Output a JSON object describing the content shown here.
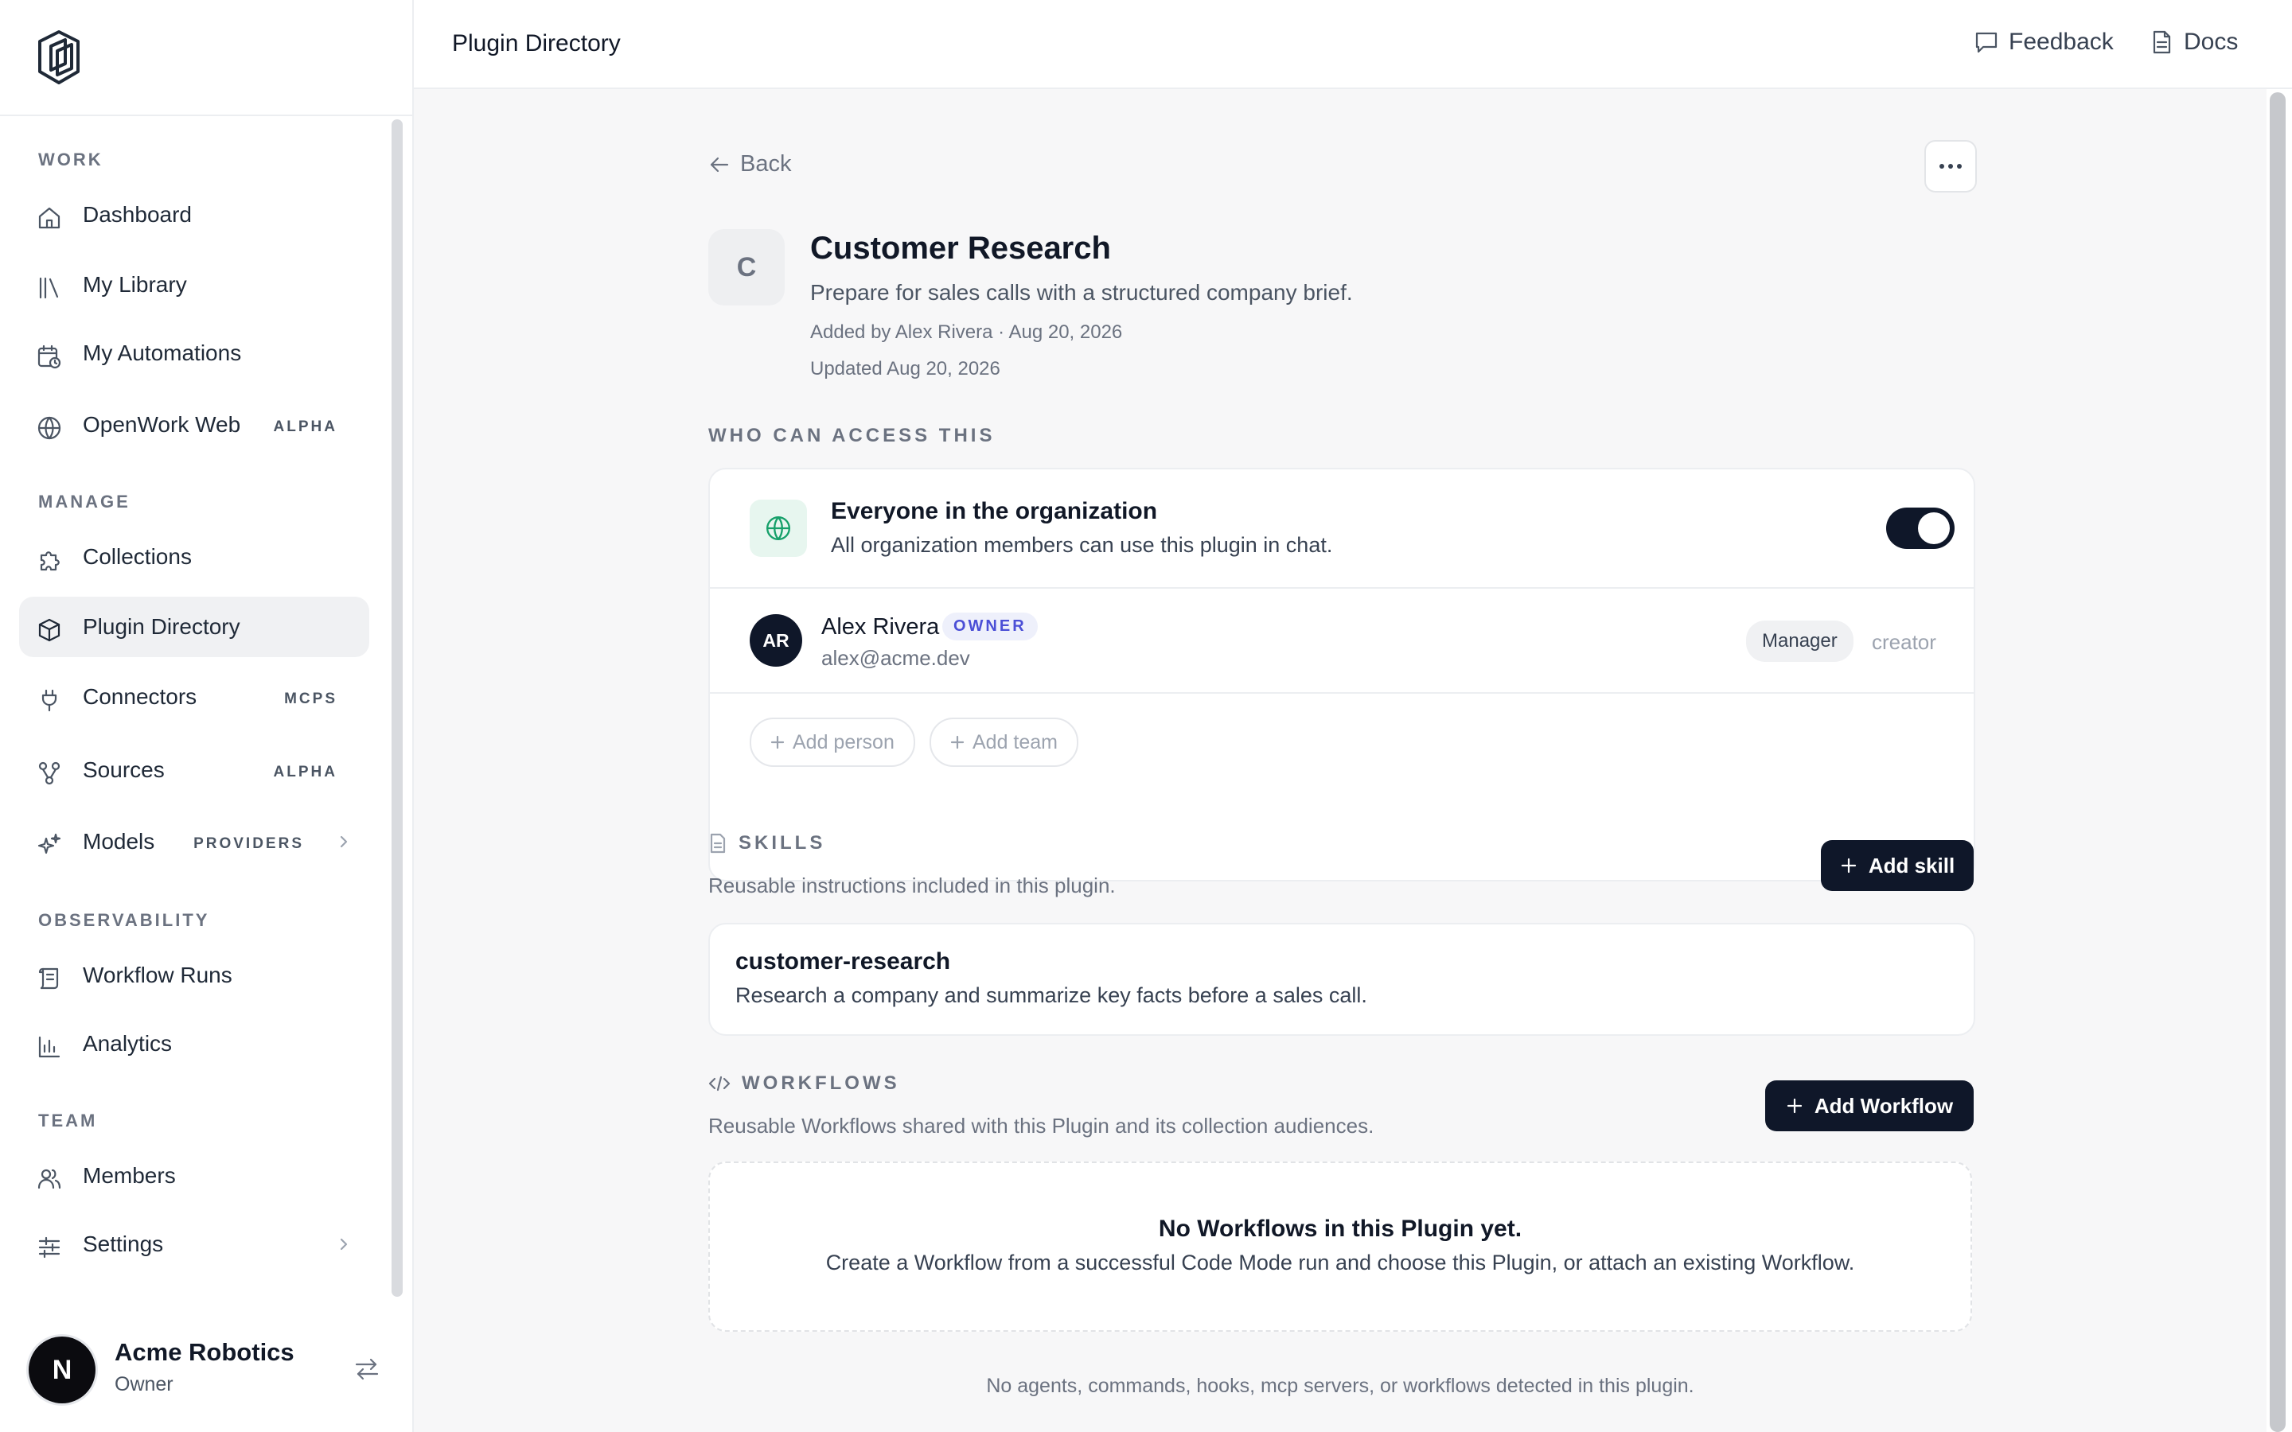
{
  "sidebar": {
    "sections": {
      "work": "WORK",
      "manage": "MANAGE",
      "observability": "OBSERVABILITY",
      "team": "TEAM"
    },
    "items": {
      "dashboard": "Dashboard",
      "library": "My Library",
      "automations": "My Automations",
      "web": "OpenWork Web",
      "web_badge": "ALPHA",
      "collections": "Collections",
      "plugins": "Plugin Directory",
      "connectors": "Connectors",
      "connectors_badge": "MCPS",
      "sources": "Sources",
      "sources_badge": "ALPHA",
      "models": "Models",
      "models_badge": "PROVIDERS",
      "workflow_runs": "Workflow Runs",
      "analytics": "Analytics",
      "members": "Members",
      "settings": "Settings"
    },
    "active_item": "Plugin Directory",
    "org": {
      "initial": "N",
      "name": "Acme Robotics",
      "role": "Owner"
    }
  },
  "topbar": {
    "breadcrumb": "Plugin Directory",
    "feedback": "Feedback",
    "docs": "Docs"
  },
  "plugin": {
    "back": "Back",
    "initial": "C",
    "name": "Customer Research",
    "description": "Prepare for sales calls with a structured company brief.",
    "added": "Added by Alex Rivera · Aug 20, 2026",
    "updated": "Updated Aug 20, 2026"
  },
  "access": {
    "heading": "WHO CAN ACCESS THIS",
    "org_title": "Everyone in the organization",
    "org_desc": "All organization members can use this plugin in chat.",
    "org_enabled": true,
    "person": {
      "initials": "AR",
      "name": "Alex Rivera",
      "badge": "OWNER",
      "email": "alex@acme.dev",
      "role": "Manager",
      "source": "creator"
    },
    "add_person": "Add person",
    "add_team": "Add team"
  },
  "skills": {
    "heading": "SKILLS",
    "description": "Reusable instructions included in this plugin.",
    "add_button": "Add skill",
    "items": [
      {
        "name": "customer-research",
        "description": "Research a company and summarize key facts before a sales call."
      }
    ]
  },
  "workflows": {
    "heading": "WORKFLOWS",
    "description": "Reusable Workflows shared with this Plugin and its collection audiences.",
    "add_button": "Add Workflow",
    "empty_title": "No Workflows in this Plugin yet.",
    "empty_desc": "Create a Workflow from a successful Code Mode run and choose this Plugin, or attach an existing Workflow."
  },
  "footnote": "No agents, commands, hooks, mcp servers, or workflows detected in this plugin.",
  "colors": {
    "primary_dark": "#0f1729",
    "owner_badge": "#4b4fd6",
    "globe_green": "#16a06a"
  }
}
